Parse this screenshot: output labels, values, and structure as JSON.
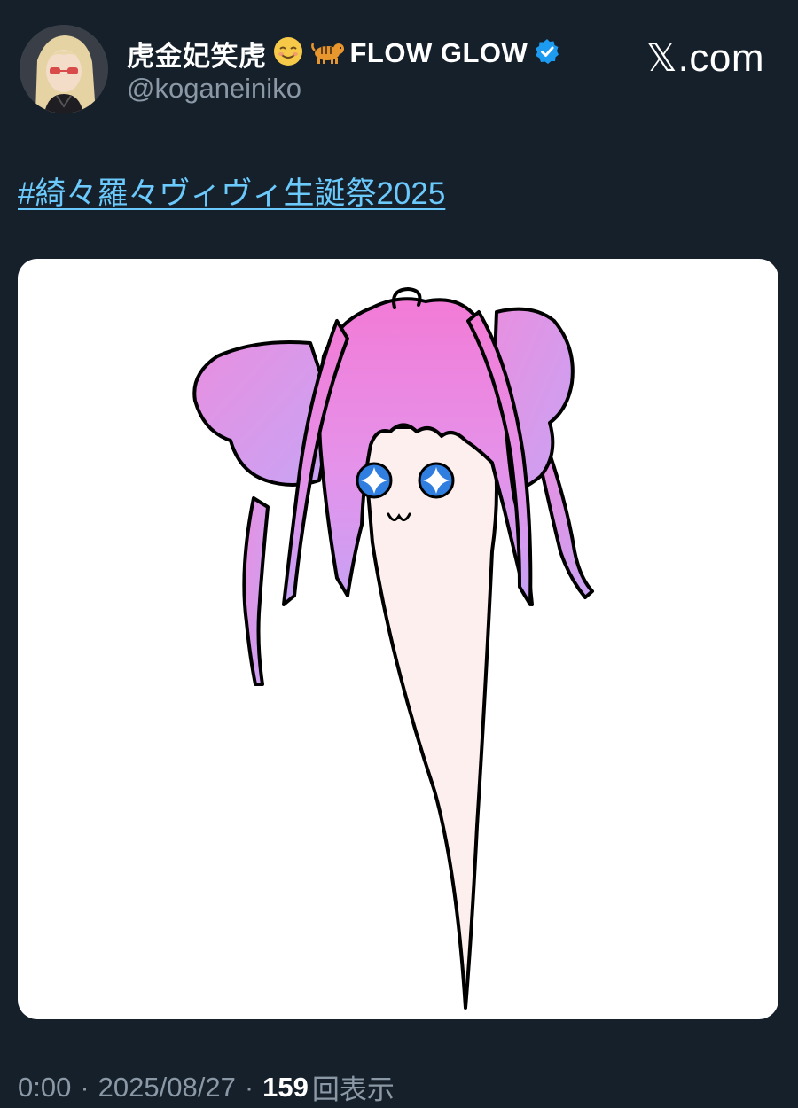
{
  "post": {
    "author": {
      "display_name": "虎金妃笑虎",
      "emoji_1": "☺️",
      "emoji_2": "🐅",
      "name_suffix": "FLOW GLOW",
      "verified_icon": "verified-badge-icon",
      "handle": "@koganeiniko"
    },
    "site_brand": {
      "x_glyph": "𝕏",
      "domain": ".com"
    },
    "hashtag": "#綺々羅々ヴィヴィ生誕祭2025",
    "media": {
      "type": "illustration"
    },
    "meta": {
      "time": "0:00",
      "separator": "·",
      "date": "2025/08/27",
      "views_count": "159",
      "views_label": "回表示"
    }
  },
  "colors": {
    "background": "#15202b",
    "text_primary": "#ffffff",
    "text_secondary": "#8b98a5",
    "link": "#6bc9fb",
    "verified": "#1d9bf0"
  }
}
